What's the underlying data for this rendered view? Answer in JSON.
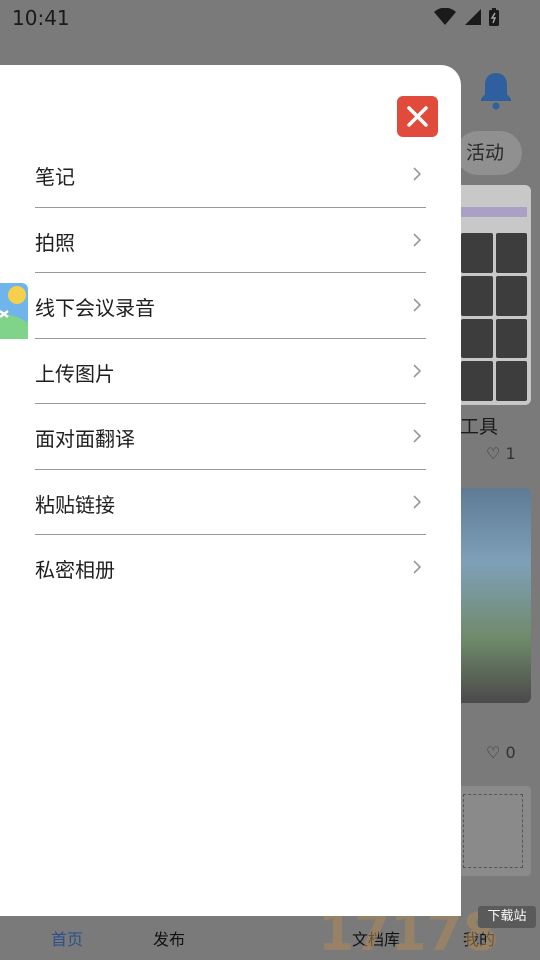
{
  "status": {
    "time": "10:41"
  },
  "background": {
    "pill_label": "活动",
    "tool_label": "工具",
    "card1_likes": "1",
    "card2_likes": "0"
  },
  "tabbar": {
    "home": "首页",
    "publish": "发布",
    "library": "文档库",
    "me": "我的"
  },
  "watermark": {
    "text": "17178",
    "badge": "下载站"
  },
  "drawer": {
    "items": [
      {
        "label": "笔记"
      },
      {
        "label": "拍照"
      },
      {
        "label": "线下会议录音"
      },
      {
        "label": "上传图片"
      },
      {
        "label": "面对面翻译"
      },
      {
        "label": "粘贴链接"
      },
      {
        "label": "私密相册"
      }
    ]
  },
  "colors": {
    "close": "#e04b3c",
    "accent": "#2d4f8a",
    "bell": "#2f5f9e"
  }
}
